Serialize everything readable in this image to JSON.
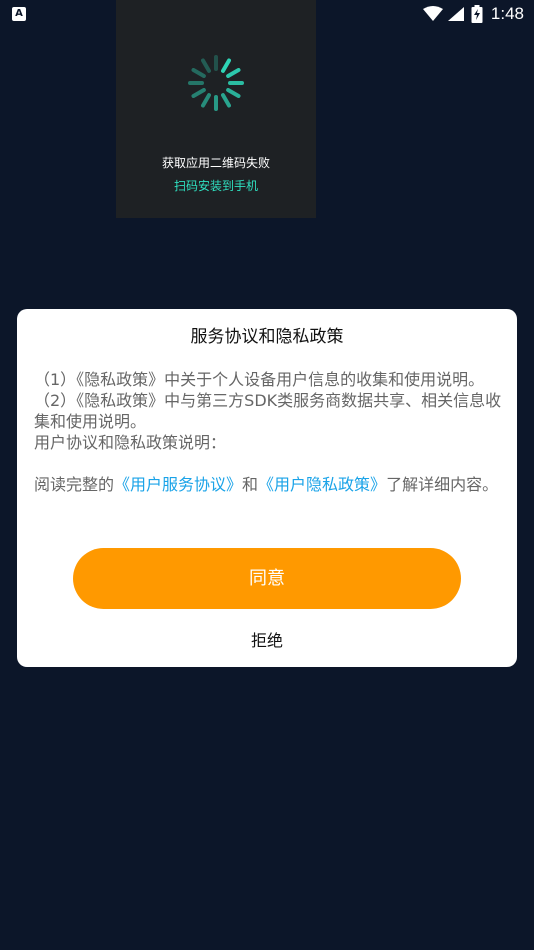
{
  "status_bar": {
    "app_icon_label": "A",
    "time": "1:48",
    "icons": [
      "wifi-icon",
      "signal-icon",
      "battery-charging-icon"
    ]
  },
  "loading_panel": {
    "error_text": "获取应用二维码失败",
    "hint_text": "扫码安装到手机",
    "hint_color": "#2fe0c0"
  },
  "dialog": {
    "title": "服务协议和隐私政策",
    "line1": "（1）《隐私政策》中关于个人设备用户信息的收集和使用说明。",
    "line2": "（2）《隐私政策》中与第三方SDK类服务商数据共享、相关信息收集和使用说明。",
    "line3": "用户协议和隐私政策说明：",
    "read_prefix": "阅读完整的",
    "user_agreement_link": "《用户服务协议》",
    "read_and": "和",
    "privacy_policy_link": "《用户隐私政策》",
    "read_suffix": "了解详细内容。",
    "agree_label": "同意",
    "reject_label": "拒绝",
    "accent_color": "#ff9900",
    "link_color": "#1aa3e8"
  }
}
